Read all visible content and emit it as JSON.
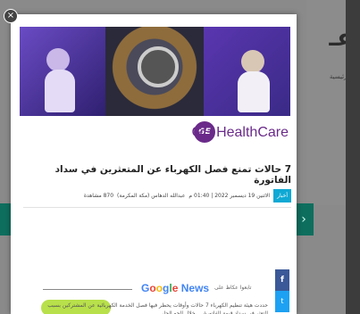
{
  "background": {
    "site_logo": "عـ",
    "home_label": "الرئيسية",
    "nav_arrow": "›"
  },
  "modal": {
    "close_glyph": "×",
    "brand": {
      "icon_text": "GE",
      "name": "GE HealthCare",
      "color": "#6a2a8a"
    },
    "headline": "7 حالات تمنع فصل الكهرباء عن المتعثرين في سداد الفاتورة",
    "meta": {
      "tag": "أخبار",
      "date": "الاثنين 19 ديسمبر 2022 | 01:40 م",
      "author": "عبدالله الدهاس (مكة المكرمة)",
      "views": "870 مشاهدة"
    },
    "google_news": {
      "follow_text": "تابعوا عكاظ على",
      "g": "G",
      "o1": "o",
      "o2": "o",
      "g2": "g",
      "l": "l",
      "e": "e",
      "news": "News"
    },
    "paragraph": "حددت هيئة تنظيم الكهرباء 7 حالات وأوقات يحظر فيها فصل الخدمة الكهربائية عن المشتركين بسبب التعثر في سداد قيمة الفاتورة ... خلال الجو الحار",
    "share": {
      "facebook": "f",
      "twitter": "t"
    }
  }
}
